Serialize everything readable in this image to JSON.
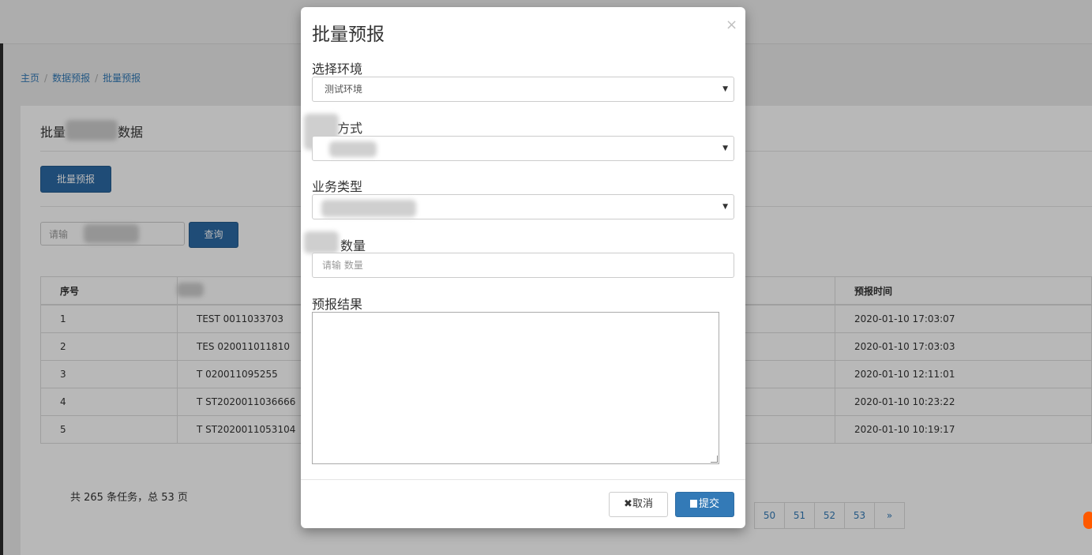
{
  "breadcrumb": {
    "home": "主页",
    "section": "数据预报",
    "current": "批量预报"
  },
  "panel": {
    "title_prefix": "批量",
    "title_suffix": "数据",
    "batch_button": "批量预报",
    "search_placeholder": "请输",
    "query_button": "查询",
    "table": {
      "headers": [
        "序号",
        "",
        "预报时间"
      ],
      "rows": [
        {
          "no": "1",
          "code": "TEST 0011033703",
          "time": "2020-01-10 17:03:07"
        },
        {
          "no": "2",
          "code": "TES 020011011810",
          "time": "2020-01-10 17:03:03"
        },
        {
          "no": "3",
          "code": "T 020011095255",
          "time": "2020-01-10 12:11:01"
        },
        {
          "no": "4",
          "code": "T ST2020011036666",
          "time": "2020-01-10 10:23:22"
        },
        {
          "no": "5",
          "code": "T ST2020011053104",
          "time": "2020-01-10 10:19:17"
        }
      ]
    },
    "summary": "共 265 条任务，总 53 页",
    "pager": [
      "50",
      "51",
      "52",
      "53",
      "»"
    ]
  },
  "modal": {
    "title": "批量预报",
    "close": "×",
    "env_label": "选择环境",
    "env_value": "测试环境",
    "method_label": "方式",
    "biz_label": "业务类型",
    "qty_label": "数量",
    "qty_placeholder": "请输 数量",
    "result_label": "预报结果",
    "cancel": "✖取消",
    "submit": "提交"
  }
}
